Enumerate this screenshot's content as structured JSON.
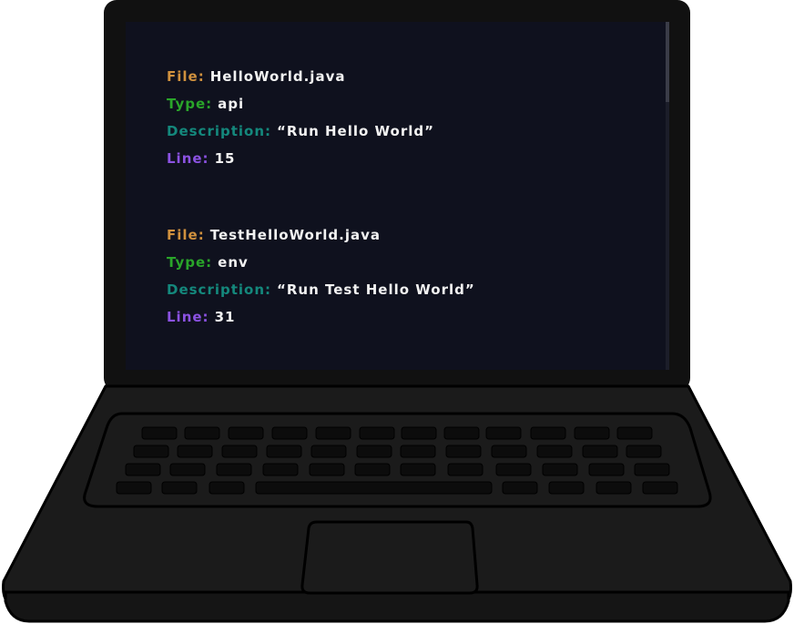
{
  "labels": {
    "file": "File:",
    "type": "Type:",
    "description": "Description:",
    "line": "Line:"
  },
  "entries": [
    {
      "file": "HelloWorld.java",
      "type": "api",
      "description": "“Run Hello World”",
      "line": "15"
    },
    {
      "file": "TestHelloWorld.java",
      "type": "env",
      "description": "“Run Test Hello World”",
      "line": "31"
    }
  ],
  "colors": {
    "file_label": "#d0913e",
    "type_label": "#2aa52a",
    "description_label": "#14887c",
    "line_label": "#8b52e2",
    "value_text": "#f2f2f2",
    "screen_background": "#0f111e",
    "laptop_body": "#1a1a1a"
  }
}
